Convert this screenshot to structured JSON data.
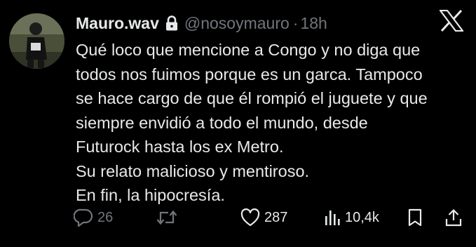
{
  "author": {
    "display_name": "Mauro.wav",
    "handle": "@nosoymauro",
    "separator": "·",
    "time": "18h",
    "protected_icon": "lock-icon",
    "avatar": "user-avatar-photo"
  },
  "brand": {
    "logo": "x-logo-icon"
  },
  "tweet": {
    "lines": [
      "Qué loco que mencione a Congo y no diga que",
      "todos nos fuimos porque es un garca. Tampoco",
      "se hace cargo de que él rompió el juguete y que",
      "siempre envidió a todo el mundo, desde",
      "Futurock hasta los ex Metro.",
      "Su relato malicioso y mentiroso.",
      "En fin, la hipocresía."
    ]
  },
  "actions": {
    "reply": {
      "icon": "reply-icon",
      "count": "26"
    },
    "retweet": {
      "icon": "retweet-icon",
      "count": ""
    },
    "like": {
      "icon": "heart-icon",
      "count": "287"
    },
    "views": {
      "icon": "views-chart-icon",
      "count": "10,4k"
    },
    "bookmark": {
      "icon": "bookmark-icon"
    },
    "share": {
      "icon": "share-icon"
    }
  },
  "colors": {
    "background": "#000000",
    "text_primary": "#e7e9ea",
    "text_secondary": "#71767b"
  }
}
